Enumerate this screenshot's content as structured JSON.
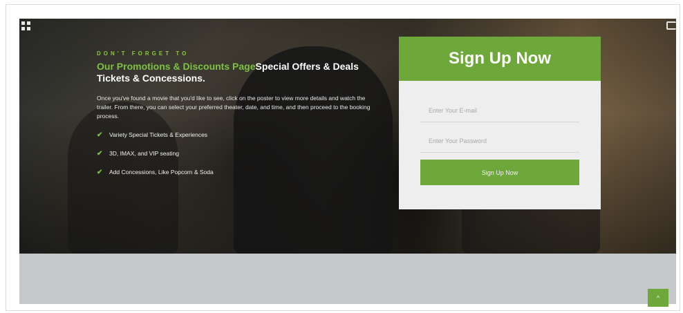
{
  "hero": {
    "eyebrow": "DON'T FORGET TO",
    "headline_green": "Our Promotions & Discounts Page",
    "headline_white": "Special Offers & Deals Tickets & Concessions.",
    "description": "Once you've found a movie that you'd like to see, click on the poster to view more details and watch the trailer. From there, you can select your preferred theater, date, and time, and then proceed to the booking process.",
    "features": [
      {
        "label": "Variety Special Tickets & Experiences",
        "icon": "check-icon"
      },
      {
        "label": "3D, IMAX, and VIP seating",
        "icon": "check-icon"
      },
      {
        "label": "Add Concessions, Like Popcorn & Soda",
        "icon": "check-icon"
      }
    ]
  },
  "signup": {
    "title": "Sign Up Now",
    "email_placeholder": "Enter Your E-mail",
    "password_placeholder": "Enter Your Password",
    "button_label": "Sign Up Now"
  },
  "icons": {
    "top_left": "grid-icon",
    "top_right": "exit-icon",
    "scroll_top": "arrow-up-icon",
    "scroll_top_glyph": "^"
  },
  "colors": {
    "accent": "#6ea73a",
    "accent_text": "#7dc242"
  }
}
